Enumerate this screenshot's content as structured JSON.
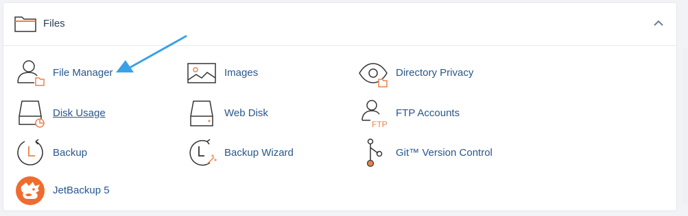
{
  "section": {
    "title": "Files"
  },
  "items": [
    {
      "label": "File Manager"
    },
    {
      "label": "Images"
    },
    {
      "label": "Directory Privacy"
    },
    {
      "label": "Disk Usage"
    },
    {
      "label": "Web Disk"
    },
    {
      "label": "FTP Accounts"
    },
    {
      "label": "Backup"
    },
    {
      "label": "Backup Wizard"
    },
    {
      "label": "Git™ Version Control"
    },
    {
      "label": "JetBackup 5"
    }
  ],
  "ftp_icon_text": "FTP",
  "colors": {
    "link": "#26568f",
    "accent_orange": "#e8804a",
    "arrow": "#3aa0e8",
    "jetbackup": "#ef6c2e"
  }
}
